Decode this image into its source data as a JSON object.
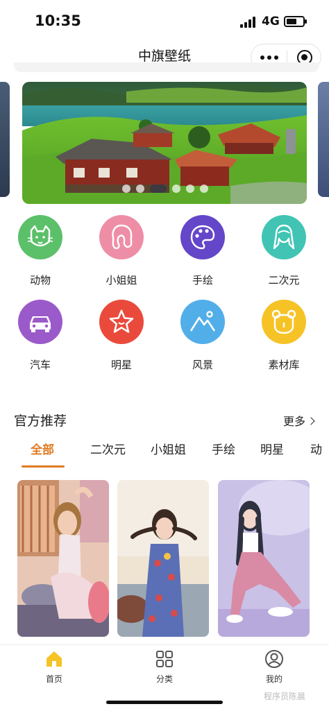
{
  "status_bar": {
    "time": "10:35",
    "network": "4G"
  },
  "nav": {
    "title": "中旗壁纸"
  },
  "banner": {
    "slide_count": 6,
    "active_index": 2
  },
  "categories": [
    {
      "label": "动物",
      "icon": "cat-icon",
      "color": "#5cc06a"
    },
    {
      "label": "小姐姐",
      "icon": "girl-icon",
      "color": "#ee8ea6"
    },
    {
      "label": "手绘",
      "icon": "palette-icon",
      "color": "#6446c9"
    },
    {
      "label": "二次元",
      "icon": "anime-icon",
      "color": "#41c4b4"
    },
    {
      "label": "汽车",
      "icon": "car-icon",
      "color": "#9b5ac9"
    },
    {
      "label": "明星",
      "icon": "star-icon",
      "color": "#ea4a3c"
    },
    {
      "label": "风景",
      "icon": "mountain-icon",
      "color": "#52aee9"
    },
    {
      "label": "素材库",
      "icon": "bear-icon",
      "color": "#f6c327"
    }
  ],
  "recommend": {
    "title": "官方推荐",
    "more": "更多",
    "tabs": [
      "全部",
      "二次元",
      "小姐姐",
      "手绘",
      "明星",
      "动"
    ],
    "active_tab": 0
  },
  "tabbar": {
    "items": [
      {
        "label": "首页",
        "icon": "home-icon",
        "active": true
      },
      {
        "label": "分类",
        "icon": "grid-icon",
        "active": false
      },
      {
        "label": "我的",
        "icon": "user-icon",
        "active": false
      }
    ],
    "active_color": "#f6c327"
  },
  "watermark": "程序员陈晨"
}
